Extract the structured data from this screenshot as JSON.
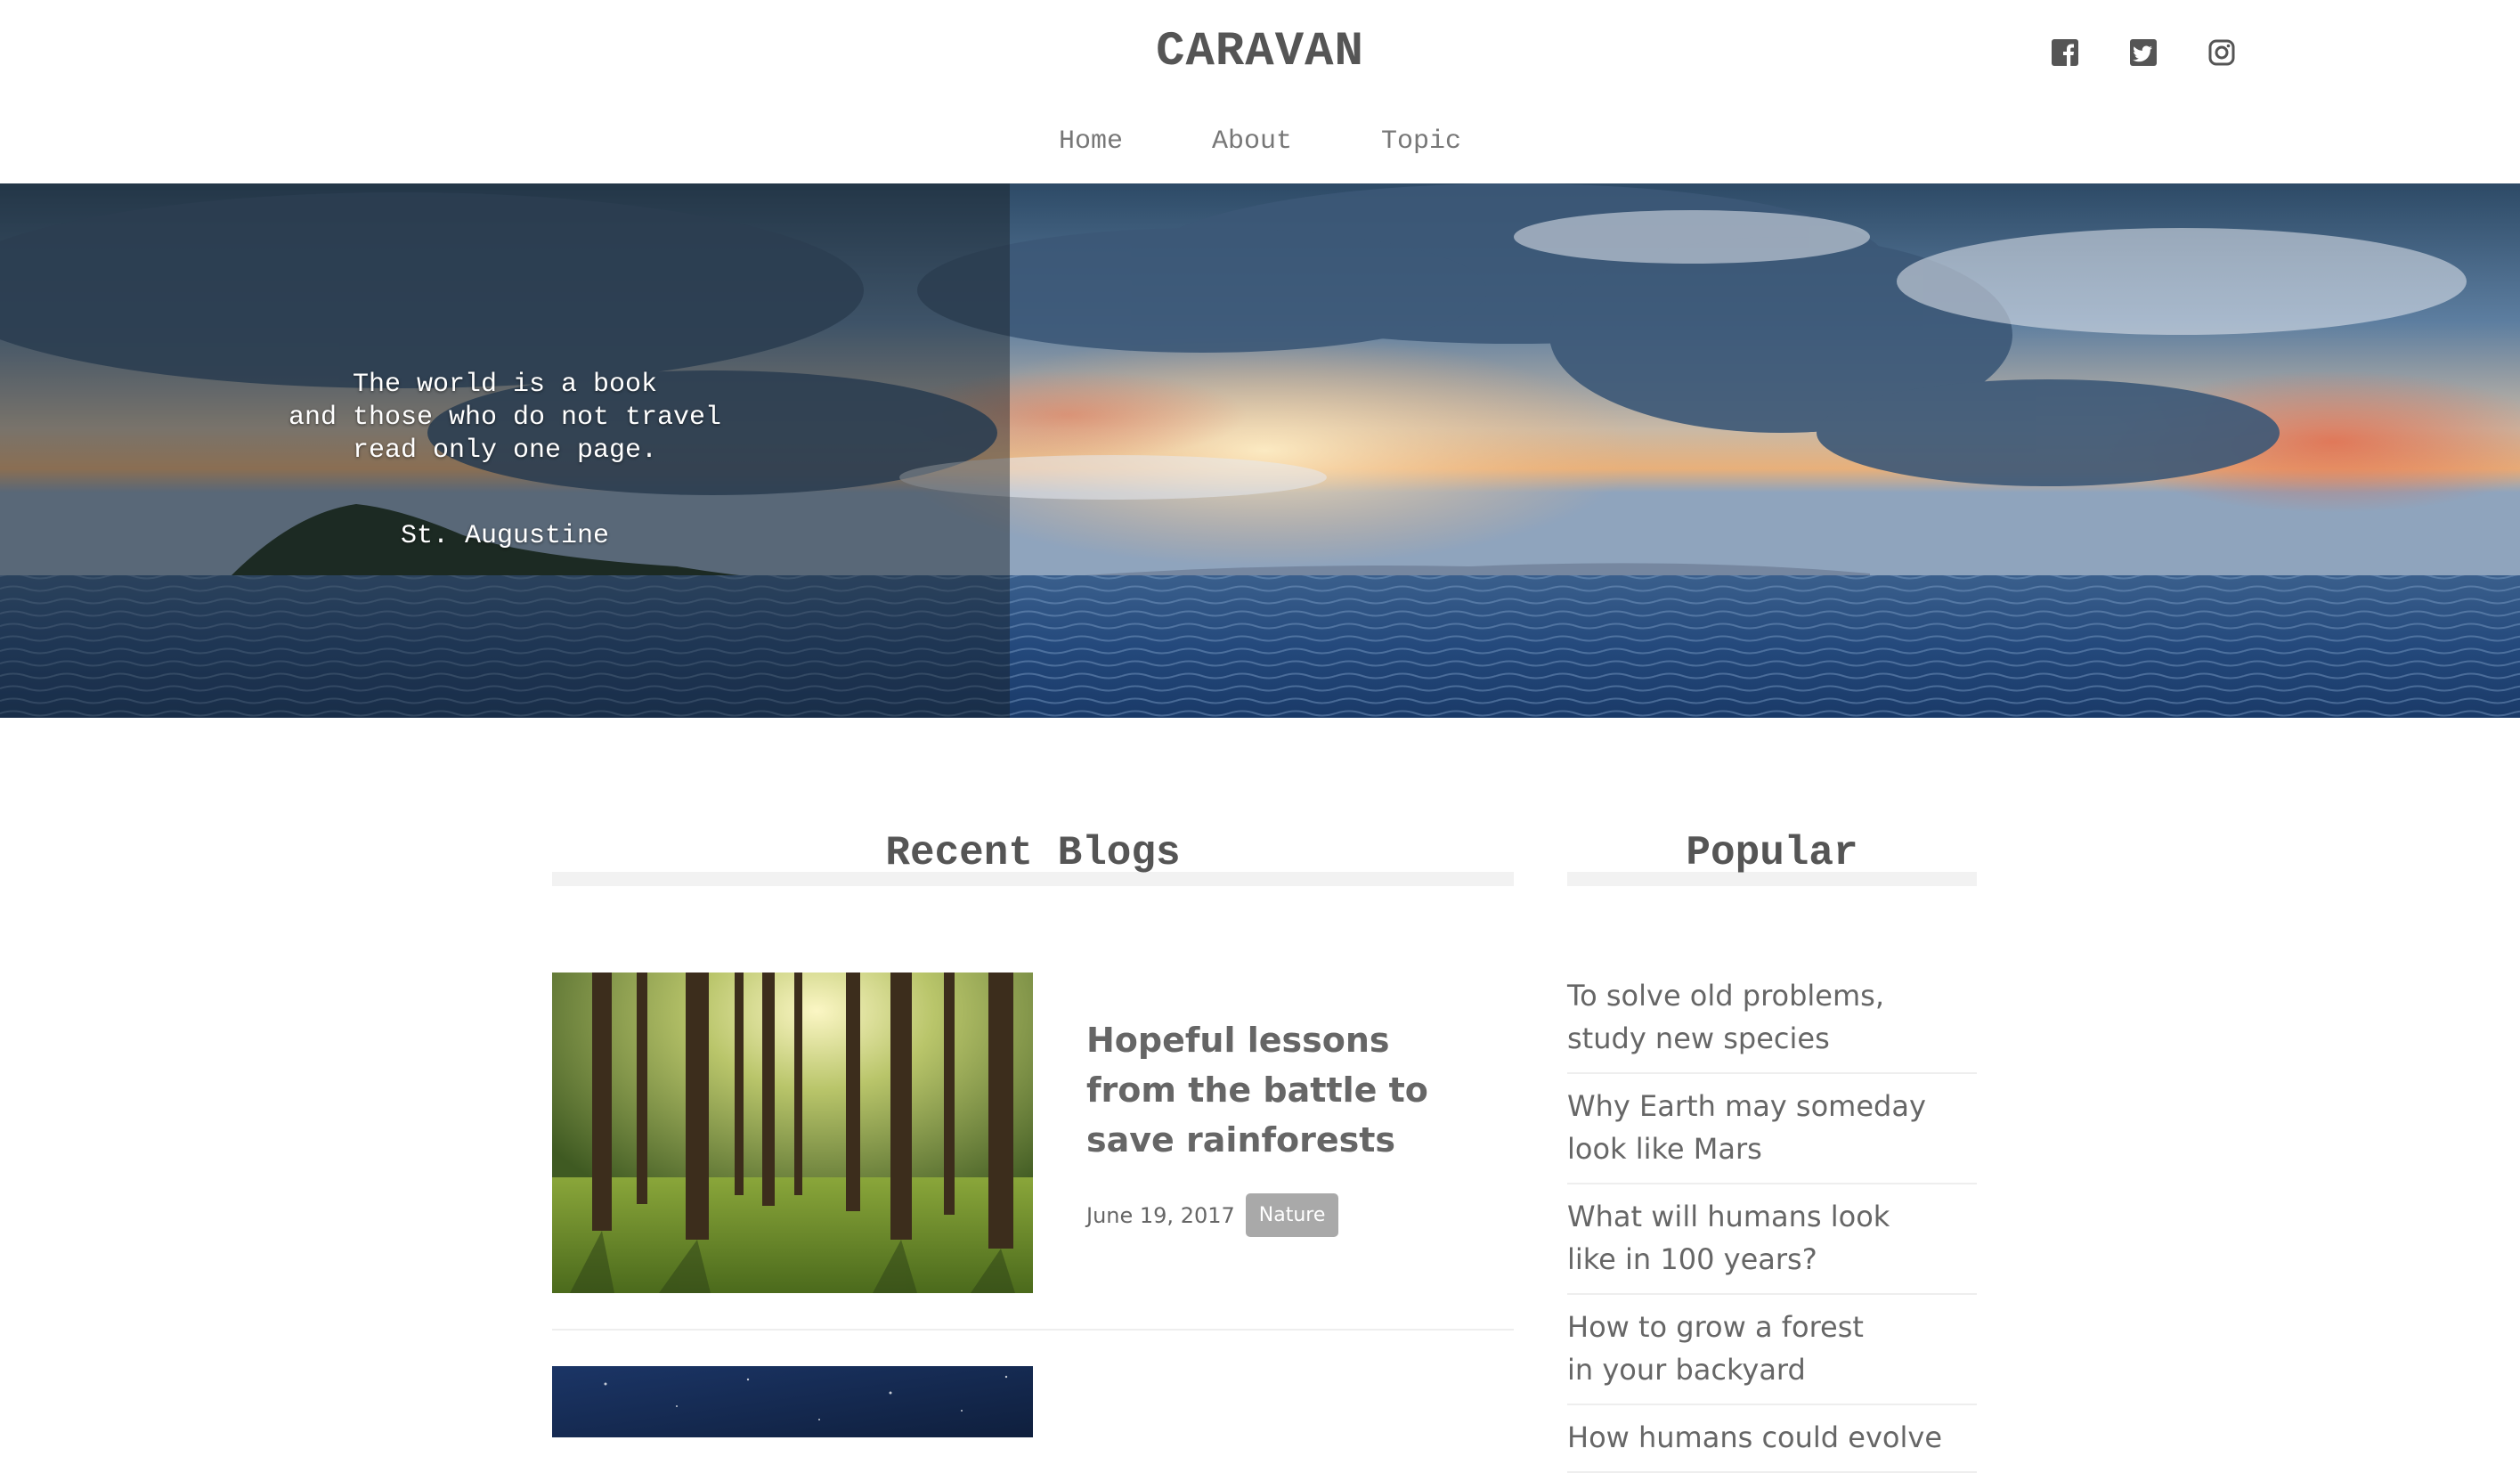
{
  "site": {
    "title": "CARAVAN"
  },
  "social": [
    {
      "name": "facebook-icon"
    },
    {
      "name": "twitter-icon"
    },
    {
      "name": "instagram-icon"
    }
  ],
  "nav": {
    "items": [
      "Home",
      "About",
      "Topic"
    ]
  },
  "hero": {
    "quote": "The world is a book\nand those who do not travel\nread only one page.",
    "author": "St. Augustine"
  },
  "recent": {
    "heading": "Recent Blogs",
    "posts": [
      {
        "title": "Hopeful lessons from the battle to save rainforests",
        "date": "June 19, 2017",
        "tag": "Nature",
        "image": "forest-photo"
      },
      {
        "image": "night-sky-photo"
      }
    ]
  },
  "popular": {
    "heading": "Popular",
    "items": [
      "To solve old problems,\nstudy new species",
      "Why Earth may someday\nlook like Mars",
      "What will humans look\nlike in 100 years?",
      "How to grow a forest\nin your backyard",
      "How humans could evolve"
    ]
  }
}
